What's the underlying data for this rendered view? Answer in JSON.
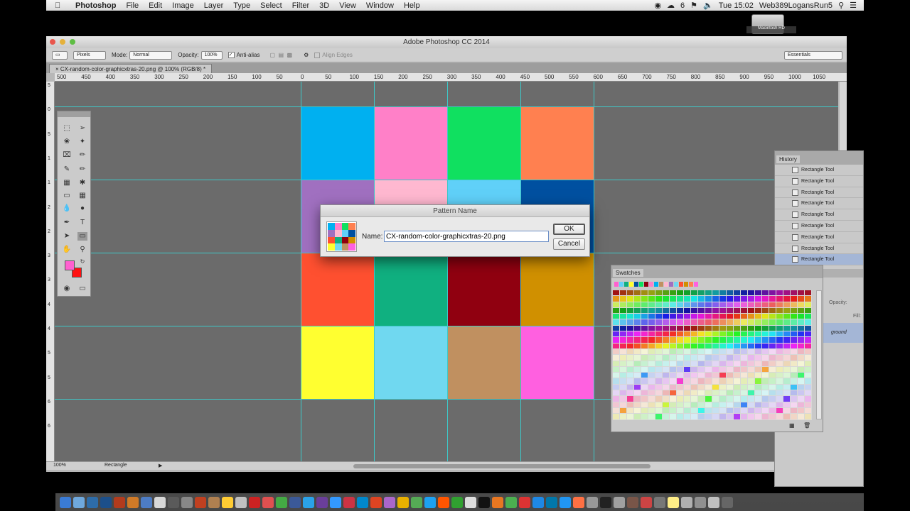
{
  "menubar": {
    "app": "Photoshop",
    "items": [
      "File",
      "Edit",
      "Image",
      "Layer",
      "Type",
      "Select",
      "Filter",
      "3D",
      "View",
      "Window",
      "Help"
    ],
    "right": {
      "badge": "6",
      "time": "Tue 15:02",
      "user": "Web389LogansRun5"
    }
  },
  "desktop": {
    "hd_label": "Macintosh HD"
  },
  "window": {
    "title": "Adobe Photoshop CC 2014"
  },
  "options": {
    "units": "Pixels",
    "mode_label": "Mode:",
    "mode": "Normal",
    "opacity_label": "Opacity:",
    "opacity": "100%",
    "antialias": "Anti-alias",
    "align_edges": "Align Edges",
    "workspace": "Essentials"
  },
  "document": {
    "tab": "CX-random-color-graphicxtras-20.png @ 100% (RGB/8) *",
    "zoom": "100%",
    "status": "Rectangle",
    "grid_colors": [
      "#00b0f0",
      "#ff80c8",
      "#10e060",
      "#ff8050",
      "#a070c0",
      "#ffb8d0",
      "#60d0f8",
      "#0050a0",
      "#ff5030",
      "#10b080",
      "#900010",
      "#d09000",
      "#ffff30",
      "#70d8f0",
      "#c09060",
      "#ff60e0"
    ]
  },
  "ruler_top": [
    "500",
    "450",
    "400",
    "350",
    "300",
    "250",
    "200",
    "150",
    "100",
    "50",
    "0",
    "50",
    "100",
    "150",
    "200",
    "250",
    "300",
    "350",
    "400",
    "450",
    "500",
    "550",
    "600",
    "650",
    "700",
    "750",
    "800",
    "850",
    "900",
    "950",
    "1000",
    "1050"
  ],
  "ruler_left": [
    "5",
    "0",
    "5",
    "1",
    "1",
    "2",
    "2",
    "3",
    "3",
    "4",
    "4",
    "5",
    "5",
    "6",
    "6"
  ],
  "tools": {
    "foreground": "#ff60d0",
    "background": "#ff1010"
  },
  "history": {
    "tab": "History",
    "items": [
      "Rectangle Tool",
      "Rectangle Tool",
      "Rectangle Tool",
      "Rectangle Tool",
      "Rectangle Tool",
      "Rectangle Tool",
      "Rectangle Tool",
      "Rectangle Tool",
      "Rectangle Tool"
    ]
  },
  "layers_fragment": {
    "opacity_label": "Opacity:",
    "fill_label": "Fill:",
    "layer_name": "ground"
  },
  "swatches": {
    "tab": "Swatches",
    "recent": [
      "#ff60d0",
      "#60d0f8",
      "#10b080",
      "#ffff30",
      "#0050a0",
      "#10e060",
      "#900010",
      "#ff80c8",
      "#00b0f0",
      "#c09060",
      "#ffb8d0",
      "#a070c0",
      "#70d8f0",
      "#ff5030",
      "#d09000",
      "#ff8050",
      "#ff60e0"
    ]
  },
  "dialog": {
    "title": "Pattern Name",
    "name_label": "Name:",
    "name_value": "CX-random-color-graphicxtras-20.png",
    "ok": "OK",
    "cancel": "Cancel"
  }
}
